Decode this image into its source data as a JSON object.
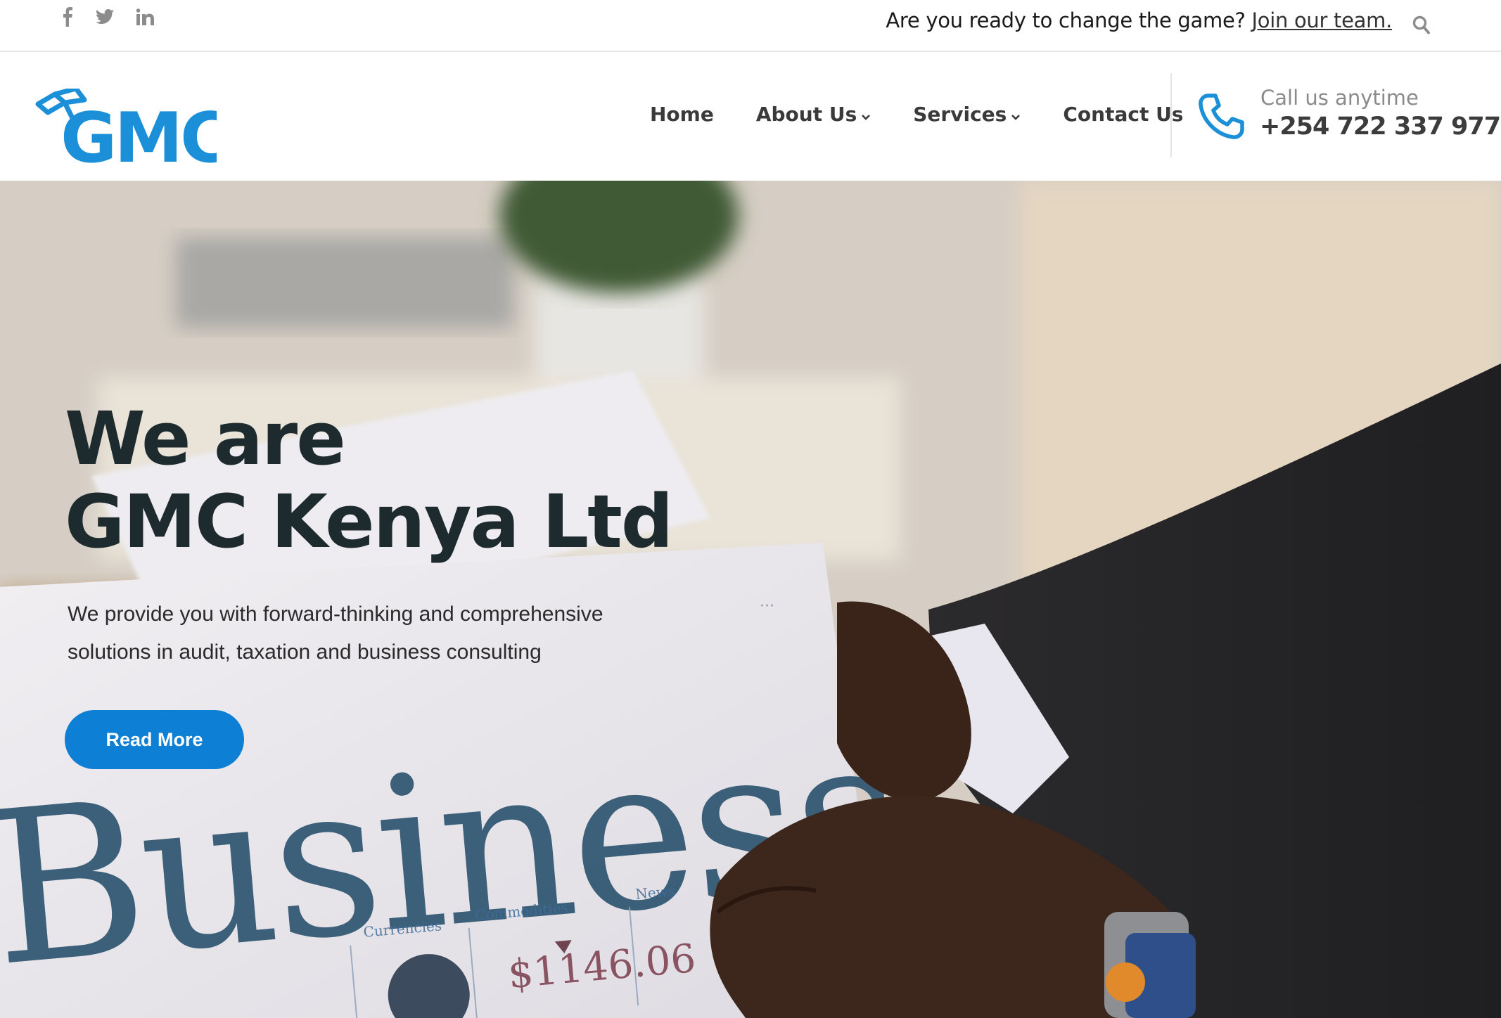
{
  "topbar": {
    "social": [
      "facebook-icon",
      "twitter-icon",
      "linkedin-icon"
    ],
    "message": "Are you ready to change the game?",
    "link_text": "Join our team."
  },
  "header": {
    "logo_text": "GMC",
    "nav": [
      {
        "label": "Home",
        "dropdown": false
      },
      {
        "label": "About Us",
        "dropdown": true
      },
      {
        "label": "Services",
        "dropdown": true
      },
      {
        "label": "Contact Us",
        "dropdown": false
      }
    ],
    "call_label": "Call us anytime",
    "call_number": "+254 722 337 977"
  },
  "hero": {
    "title_line1": "We are",
    "title_line2": "GMC Kenya Ltd",
    "description": "We provide you with forward-thinking and comprehensive solutions in audit, taxation and business consulting",
    "button_label": "Read More",
    "image_newspaper_word": "Business",
    "image_price": "$1146.06",
    "image_section_labels": [
      "Currencies",
      "Commodities",
      "News"
    ]
  },
  "colors": {
    "accent": "#0d7fd4",
    "logo_blue": "#1b8fd8",
    "heading": "#1d2a2e"
  }
}
